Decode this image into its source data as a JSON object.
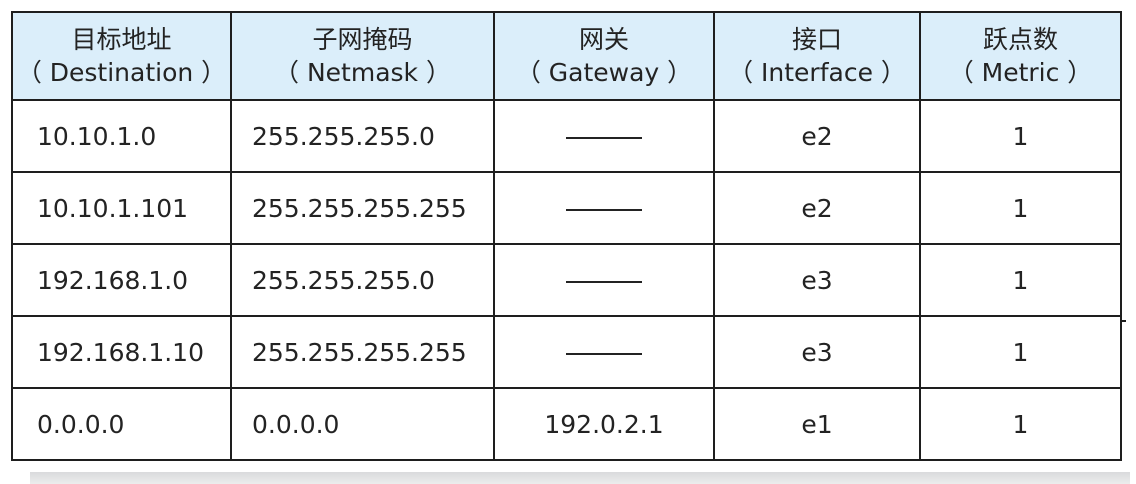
{
  "table": {
    "headers": [
      {
        "zh": "目标地址",
        "en": "（ Destination ）"
      },
      {
        "zh": "子网掩码",
        "en": "（ Netmask ）"
      },
      {
        "zh": "网关",
        "en": "（ Gateway ）"
      },
      {
        "zh": "接口",
        "en": "（ Interface ）"
      },
      {
        "zh": "跃点数",
        "en": "（ Metric ）"
      }
    ],
    "rows": [
      {
        "destination": "10.10.1.0",
        "netmask": "255.255.255.0",
        "gateway": "",
        "interface": "e2",
        "metric": "1"
      },
      {
        "destination": "10.10.1.101",
        "netmask": "255.255.255.255",
        "gateway": "",
        "interface": "e2",
        "metric": "1"
      },
      {
        "destination": "192.168.1.0",
        "netmask": "255.255.255.0",
        "gateway": "",
        "interface": "e3",
        "metric": "1"
      },
      {
        "destination": "192.168.1.10",
        "netmask": "255.255.255.255",
        "gateway": "",
        "interface": "e3",
        "metric": "1"
      },
      {
        "destination": "0.0.0.0",
        "netmask": "0.0.0.0",
        "gateway": "192.0.2.1",
        "interface": "e1",
        "metric": "1"
      }
    ]
  },
  "colors": {
    "header_background": "#dbeefa",
    "border": "#1e1e1e",
    "text": "#232323"
  }
}
